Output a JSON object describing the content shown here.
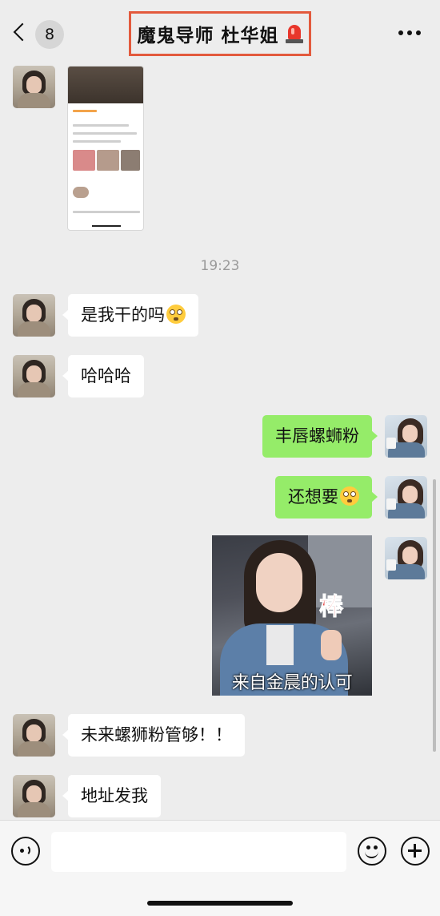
{
  "header": {
    "back_count": "8",
    "title": "魔鬼导师 杜华姐",
    "title_icon": "police-siren-icon",
    "more_icon": "more-dots-icon"
  },
  "messages": {
    "timestamp": "19:23",
    "m1": "是我干的吗",
    "m2": "哈哈哈",
    "m3": "丰唇螺蛳粉",
    "m4": "还想要",
    "sticker_caption": "来自金晨的认可",
    "sticker_badge": "棒",
    "m5": "未来螺狮粉管够！！",
    "m6": "地址发我"
  },
  "input": {
    "placeholder": "",
    "voice_icon": "voice-icon",
    "emoji_icon": "emoji-icon",
    "plus_icon": "plus-icon"
  },
  "colors": {
    "background": "#ededed",
    "sent_bubble": "#95ec69",
    "received_bubble": "#ffffff",
    "title_border": "#e35a3d"
  }
}
